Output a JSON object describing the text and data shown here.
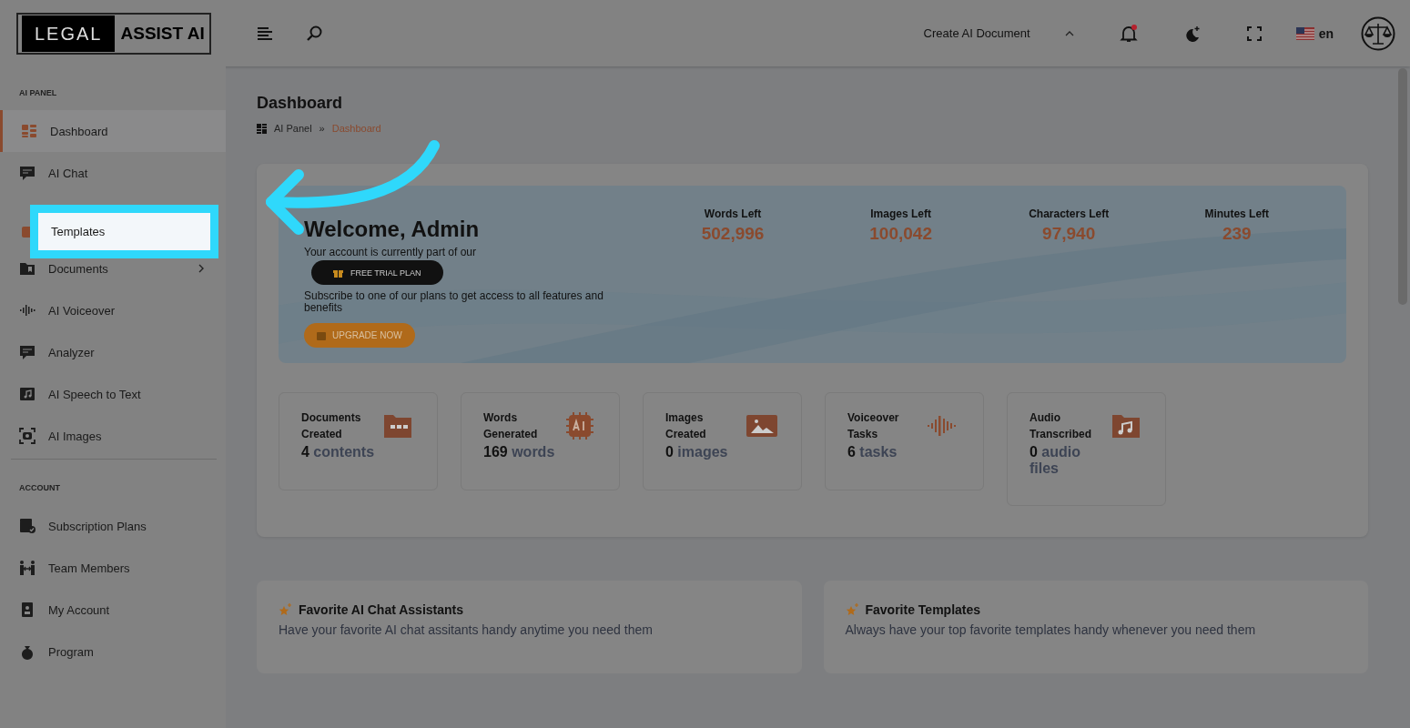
{
  "header": {
    "logo": {
      "dark_part": "LEGAL",
      "light_part": "ASSIST AI"
    },
    "create_menu": "Create AI Document",
    "notification_unread": true,
    "language": "en"
  },
  "sidebar": {
    "sections": [
      {
        "title": "AI PANEL",
        "items": [
          {
            "label": "Dashboard",
            "kind": "grid",
            "selected": true,
            "highlighted": false,
            "has_submenu": false
          },
          {
            "label": "AI Chat",
            "kind": "chat",
            "selected": false,
            "highlighted": false,
            "has_submenu": false
          },
          {
            "label": "Templates",
            "kind": "chip",
            "selected": false,
            "highlighted": true,
            "has_submenu": false
          },
          {
            "label": "Documents",
            "kind": "folder",
            "selected": false,
            "highlighted": false,
            "has_submenu": true
          },
          {
            "label": "AI Voiceover",
            "kind": "wave",
            "selected": false,
            "highlighted": false,
            "has_submenu": false
          },
          {
            "label": "Analyzer",
            "kind": "chat",
            "selected": false,
            "highlighted": false,
            "has_submenu": false
          },
          {
            "label": "AI Speech to Text",
            "kind": "music",
            "selected": false,
            "highlighted": false,
            "has_submenu": false
          },
          {
            "label": "AI Images",
            "kind": "camera",
            "selected": false,
            "highlighted": false,
            "has_submenu": false
          }
        ]
      },
      {
        "title": "ACCOUNT",
        "items": [
          {
            "label": "Subscription Plans",
            "kind": "box",
            "selected": false,
            "highlighted": false,
            "has_submenu": false
          },
          {
            "label": "Team Members",
            "kind": "team",
            "selected": false,
            "highlighted": false,
            "has_submenu": false
          },
          {
            "label": "My Account",
            "kind": "badge",
            "selected": false,
            "highlighted": false,
            "has_submenu": false
          },
          {
            "label": "Program",
            "kind": "money",
            "selected": false,
            "highlighted": false,
            "has_submenu": false
          }
        ]
      }
    ]
  },
  "page": {
    "title": "Dashboard",
    "breadcrumb": [
      {
        "label": "AI Panel",
        "current": false
      },
      {
        "label": "Dashboard",
        "current": true
      }
    ],
    "separator": "»"
  },
  "welcome": {
    "title": "Welcome, Admin",
    "plan_intro": "Your account is currently part of our",
    "plan": "FREE TRIAL PLAN",
    "subscribe_text": "Subscribe to one of our plans to get access to all features and benefits",
    "upgrade_button": "UPGRADE NOW",
    "stats": [
      {
        "label": "Words Left",
        "value": "502,996"
      },
      {
        "label": "Images Left",
        "value": "100,042"
      },
      {
        "label": "Characters Left",
        "value": "97,940"
      },
      {
        "label": "Minutes Left",
        "value": "239"
      }
    ]
  },
  "summary_cards": [
    {
      "title": "Documents Created",
      "count": "4",
      "unit": "contents",
      "kind": "folder"
    },
    {
      "title": "Words Generated",
      "count": "169",
      "unit": "words",
      "kind": "chip"
    },
    {
      "title": "Images Created",
      "count": "0",
      "unit": "images",
      "kind": "image"
    },
    {
      "title": "Voiceover Tasks",
      "count": "6",
      "unit": "tasks",
      "kind": "wave"
    },
    {
      "title": "Audio Transcribed",
      "count": "0",
      "unit": "audio files",
      "kind": "music"
    }
  ],
  "favorites": [
    {
      "title": "Favorite AI Chat Assistants",
      "subtitle": "Have your favorite AI chat assitants handy anytime you need them"
    },
    {
      "title": "Favorite Templates",
      "subtitle": "Always have your top favorite templates handy whenever you need them"
    }
  ]
}
